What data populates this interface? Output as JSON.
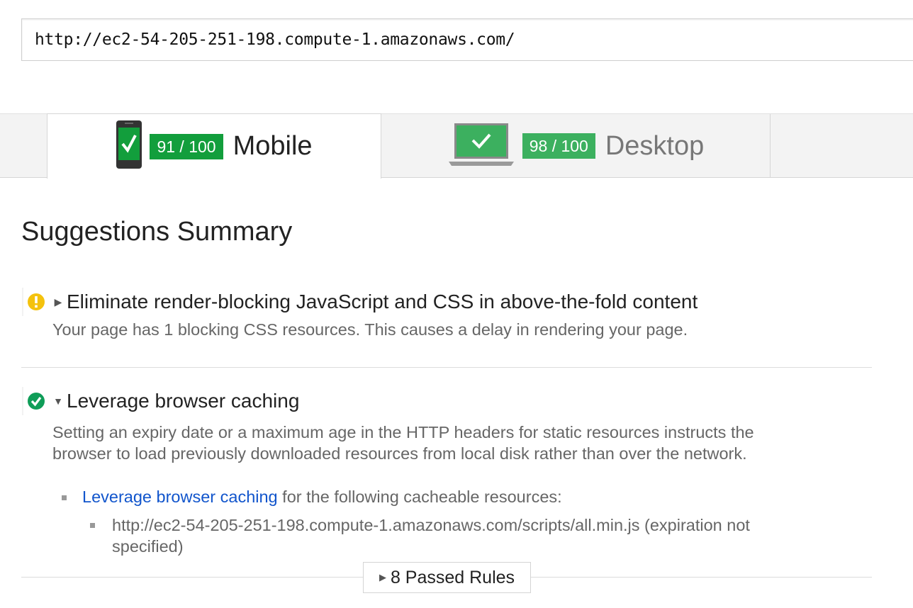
{
  "url_input": {
    "value": "http://ec2-54-205-251-198.compute-1.amazonaws.com/"
  },
  "tabs": [
    {
      "id": "mobile",
      "score": "91 / 100",
      "label": "Mobile",
      "active": true,
      "icon": "phone-check-icon"
    },
    {
      "id": "desktop",
      "score": "98 / 100",
      "label": "Desktop",
      "active": false,
      "icon": "laptop-check-icon"
    }
  ],
  "summary_title": "Suggestions Summary",
  "rules": [
    {
      "status": "warning",
      "icon": "warning-icon",
      "expanded": false,
      "title": "Eliminate render-blocking JavaScript and CSS in above-the-fold content",
      "description": "Your page has 1 blocking CSS resources. This causes a delay in rendering your page."
    },
    {
      "status": "passed",
      "icon": "check-circle-icon",
      "expanded": true,
      "title": "Leverage browser caching",
      "description_line1": "Setting an expiry date or a maximum age in the HTTP headers for static resources instructs the",
      "description_line2": "browser to load previously downloaded resources from local disk rather than over the network.",
      "detail_link": "Leverage browser caching",
      "detail_text": " for the following cacheable resources:",
      "resource_line1": "http://ec2-54-205-251-198.compute-1.amazonaws.com/scripts/all.min.js (expiration not",
      "resource_line2": "specified)"
    }
  ],
  "passed_rules_button": "8 Passed Rules",
  "colors": {
    "mobile_score_bg": "#129e3c",
    "desktop_score_bg": "#3cb05f",
    "warning": "#f4c20d",
    "passed": "#0f9d58",
    "link": "#1155cc"
  }
}
